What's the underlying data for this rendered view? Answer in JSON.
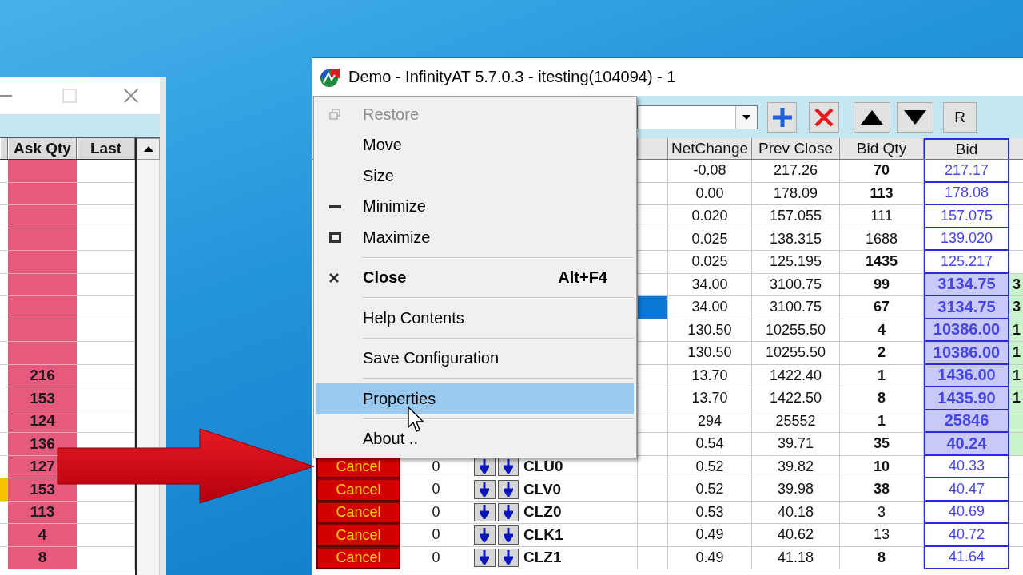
{
  "left_window": {
    "title_buttons": [
      {
        "kind": "minimize",
        "disabled": false
      },
      {
        "kind": "maximize",
        "disabled": true
      },
      {
        "kind": "close",
        "disabled": false
      }
    ],
    "table": {
      "columns": [
        "Ask Qty",
        "Last"
      ],
      "rows": [
        {
          "marked": false
        },
        {
          "marked": false
        },
        {
          "marked": false
        },
        {
          "marked": false
        },
        {
          "marked": false
        },
        {
          "marked": false
        },
        {
          "marked": false
        },
        {
          "marked": false
        },
        {
          "marked": false
        },
        {
          "marked": false,
          "ask_qty": "216"
        },
        {
          "marked": false,
          "ask_qty": "153"
        },
        {
          "marked": false,
          "ask_qty": "124"
        },
        {
          "marked": false,
          "ask_qty": "136"
        },
        {
          "marked": false,
          "ask_qty": "127"
        },
        {
          "marked": true,
          "ask_qty": "153"
        },
        {
          "marked": false,
          "ask_qty": "113"
        },
        {
          "marked": false,
          "ask_qty": "4"
        },
        {
          "marked": false,
          "ask_qty": "8"
        }
      ]
    }
  },
  "main_window": {
    "title": "Demo - InfinityAT 5.7.0.3 - itesting(104094) - 1",
    "toolbar": {
      "buttons": [
        {
          "kind": "add"
        },
        {
          "kind": "delete"
        },
        {
          "kind": "up"
        },
        {
          "kind": "down"
        },
        {
          "kind": "text",
          "label": "R"
        }
      ]
    },
    "table": {
      "columns": [
        "NetChange",
        "Prev Close",
        "Bid Qty",
        "Bid"
      ],
      "rows": [
        {
          "selected": false,
          "net_change": "-0.08",
          "prev_close": "217.26",
          "bid_qty": "70",
          "bid_qty_bold": true,
          "bid": "217.17",
          "bid_highlighted": false,
          "column_10_highlighted": false
        },
        {
          "selected": false,
          "net_change": "0.00",
          "prev_close": "178.09",
          "bid_qty": "113",
          "bid_qty_bold": true,
          "bid": "178.08",
          "bid_highlighted": false,
          "column_10_highlighted": false
        },
        {
          "selected": false,
          "net_change": "0.020",
          "prev_close": "157.055",
          "bid_qty": "111",
          "bid_qty_bold": false,
          "bid": "157.075",
          "bid_highlighted": false,
          "column_10_highlighted": false
        },
        {
          "selected": false,
          "net_change": "0.025",
          "prev_close": "138.315",
          "bid_qty": "1688",
          "bid_qty_bold": false,
          "bid": "139.020",
          "bid_highlighted": false,
          "column_10_highlighted": false
        },
        {
          "selected": false,
          "net_change": "0.025",
          "prev_close": "125.195",
          "bid_qty": "1435",
          "bid_qty_bold": true,
          "bid": "125.217",
          "bid_highlighted": false,
          "column_10_highlighted": false
        },
        {
          "selected": false,
          "net_change": "34.00",
          "prev_close": "3100.75",
          "bid_qty": "99",
          "bid_qty_bold": true,
          "bid": "3134.75",
          "bid_highlighted": true,
          "column_10": "3",
          "column_10_highlighted": true
        },
        {
          "selected": true,
          "net_change": "34.00",
          "prev_close": "3100.75",
          "bid_qty": "67",
          "bid_qty_bold": true,
          "bid": "3134.75",
          "bid_highlighted": true,
          "column_10": "3",
          "column_10_highlighted": true
        },
        {
          "selected": false,
          "net_change": "130.50",
          "prev_close": "10255.50",
          "bid_qty": "4",
          "bid_qty_bold": true,
          "bid": "10386.00",
          "bid_highlighted": true,
          "column_10": "1",
          "column_10_highlighted": true
        },
        {
          "selected": false,
          "net_change": "130.50",
          "prev_close": "10255.50",
          "bid_qty": "2",
          "bid_qty_bold": true,
          "bid": "10386.00",
          "bid_highlighted": true,
          "column_10": "1",
          "column_10_highlighted": true
        },
        {
          "selected": false,
          "net_change": "13.70",
          "prev_close": "1422.40",
          "bid_qty": "1",
          "bid_qty_bold": true,
          "bid": "1436.00",
          "bid_highlighted": true,
          "column_10": "1",
          "column_10_highlighted": true
        },
        {
          "selected": false,
          "net_change": "13.70",
          "prev_close": "1422.50",
          "bid_qty": "8",
          "bid_qty_bold": true,
          "bid": "1435.90",
          "bid_highlighted": true,
          "column_10": "1",
          "column_10_highlighted": true
        },
        {
          "selected": false,
          "net_change": "294",
          "prev_close": "25552",
          "bid_qty": "1",
          "bid_qty_bold": true,
          "bid": "25846",
          "bid_highlighted": true,
          "column_10_highlighted": true
        },
        {
          "selected": false,
          "net_change": "0.54",
          "prev_close": "39.71",
          "bid_qty": "35",
          "bid_qty_bold": true,
          "bid": "40.24",
          "bid_highlighted": true,
          "column_10_highlighted": true
        },
        {
          "selected": false,
          "cancel": "Cancel",
          "qty": "0",
          "symbol": "CLU0",
          "net_change": "0.52",
          "prev_close": "39.82",
          "bid_qty": "10",
          "bid_qty_bold": true,
          "bid": "40.33",
          "bid_highlighted": false,
          "column_10_highlighted": false
        },
        {
          "selected": false,
          "cancel": "Cancel",
          "qty": "0",
          "symbol": "CLV0",
          "net_change": "0.52",
          "prev_close": "39.98",
          "bid_qty": "38",
          "bid_qty_bold": true,
          "bid": "40.47",
          "bid_highlighted": false,
          "column_10_highlighted": false
        },
        {
          "selected": false,
          "cancel": "Cancel",
          "qty": "0",
          "symbol": "CLZ0",
          "net_change": "0.53",
          "prev_close": "40.18",
          "bid_qty": "3",
          "bid_qty_bold": false,
          "bid": "40.69",
          "bid_highlighted": false,
          "column_10_highlighted": false
        },
        {
          "selected": false,
          "cancel": "Cancel",
          "qty": "0",
          "symbol": "CLK1",
          "net_change": "0.49",
          "prev_close": "40.62",
          "bid_qty": "13",
          "bid_qty_bold": false,
          "bid": "40.72",
          "bid_highlighted": false,
          "column_10_highlighted": false
        },
        {
          "selected": false,
          "cancel": "Cancel",
          "qty": "0",
          "symbol": "CLZ1",
          "net_change": "0.49",
          "prev_close": "41.18",
          "bid_qty": "8",
          "bid_qty_bold": true,
          "bid": "41.64",
          "bid_highlighted": false,
          "column_10_highlighted": false
        }
      ]
    }
  },
  "system_menu": {
    "groups": [
      [
        {
          "label": "Restore",
          "kind": "restore",
          "disabled": true,
          "default": false,
          "selected": false
        },
        {
          "label": "Move",
          "kind": "plain",
          "disabled": false,
          "default": false,
          "selected": false
        },
        {
          "label": "Size",
          "kind": "plain",
          "disabled": false,
          "default": false,
          "selected": false
        },
        {
          "label": "Minimize",
          "kind": "minimize",
          "disabled": false,
          "default": false,
          "selected": false
        },
        {
          "label": "Maximize",
          "kind": "maximize",
          "disabled": false,
          "default": false,
          "selected": false
        }
      ],
      [
        {
          "label": "Close",
          "kind": "close",
          "shortcut": "Alt+F4",
          "disabled": false,
          "default": true,
          "selected": false
        }
      ],
      [
        {
          "label": "Help Contents",
          "kind": "plain",
          "disabled": false,
          "default": false,
          "selected": false
        }
      ],
      [
        {
          "label": "Save Configuration",
          "kind": "plain",
          "disabled": false,
          "default": false,
          "selected": false
        }
      ],
      [
        {
          "label": "Properties",
          "kind": "plain",
          "disabled": false,
          "default": false,
          "selected": true
        }
      ],
      [
        {
          "label": "About ..",
          "kind": "plain",
          "disabled": false,
          "default": false,
          "selected": false
        }
      ]
    ]
  }
}
